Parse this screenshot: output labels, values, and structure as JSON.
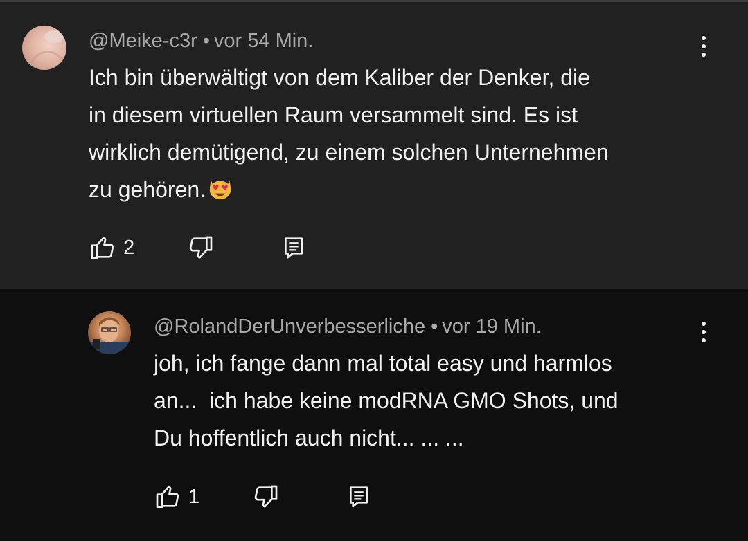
{
  "comments": [
    {
      "author": "@Meike-c3r",
      "separator": "•",
      "time": "vor 54 Min.",
      "lines": [
        "Ich bin überwältigt von dem Kaliber der Denker, die",
        "in diesem virtuellen Raum versammelt sind. Es ist",
        "wirklich demütigend, zu einem solchen Unternehmen",
        "zu gehören."
      ],
      "emoji": "smiling-cat-heart-eyes",
      "likes": "2"
    },
    {
      "author": "@RolandDerUnverbesserliche",
      "separator": "•",
      "time": "vor 19 Min.",
      "lines": [
        "joh, ich fange dann mal total easy und harmlos",
        "an...  ich habe keine modRNA GMO Shots, und",
        "Du hoffentlich auch nicht... ... ..."
      ],
      "likes": "1"
    }
  ],
  "icons": {
    "like": "thumbs-up-icon",
    "dislike": "thumbs-down-icon",
    "reply": "comment-reply-icon",
    "menu": "more-vertical-icon"
  },
  "colors": {
    "top_bg": "#212121",
    "reply_bg": "#0f0f0f",
    "text": "#f1f1f1",
    "meta": "#aaaaaa"
  }
}
